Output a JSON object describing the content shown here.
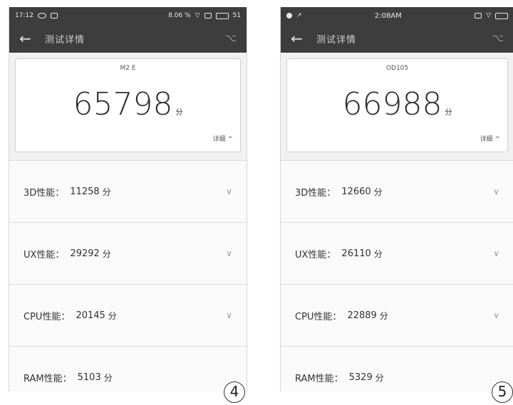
{
  "phones": [
    {
      "status": {
        "time": "17:12",
        "right_text": "8.06 %",
        "battery": "51"
      },
      "title": "测试详情",
      "model": "M2 E",
      "score": "65798",
      "score_unit": "分",
      "detail_label": "详细 ^",
      "rows": [
        {
          "label": "3D性能：",
          "value": "11258",
          "unit": "分"
        },
        {
          "label": "UX性能：",
          "value": "29292",
          "unit": "分"
        },
        {
          "label": "CPU性能：",
          "value": "20145",
          "unit": "分"
        },
        {
          "label": "RAM性能：",
          "value": "5103",
          "unit": "分"
        }
      ],
      "figure_number": "4"
    },
    {
      "status": {
        "time": "2:08AM",
        "right_text": "",
        "battery": ""
      },
      "title": "测试详情",
      "model": "OD105",
      "score": "66988",
      "score_unit": "分",
      "detail_label": "详细 ^",
      "rows": [
        {
          "label": "3D性能：",
          "value": "12660",
          "unit": "分"
        },
        {
          "label": "UX性能：",
          "value": "26110",
          "unit": "分"
        },
        {
          "label": "CPU性能：",
          "value": "22889",
          "unit": "分"
        },
        {
          "label": "RAM性能：",
          "value": "5329",
          "unit": "分"
        }
      ],
      "figure_number": "5"
    }
  ],
  "icons": {
    "back": "arrow-left-icon",
    "share": "share-icon",
    "expand": "chevron-down-icon"
  },
  "colors": {
    "appbar": "#3d3d3d",
    "background": "#f1f1f1",
    "card": "#ffffff"
  }
}
